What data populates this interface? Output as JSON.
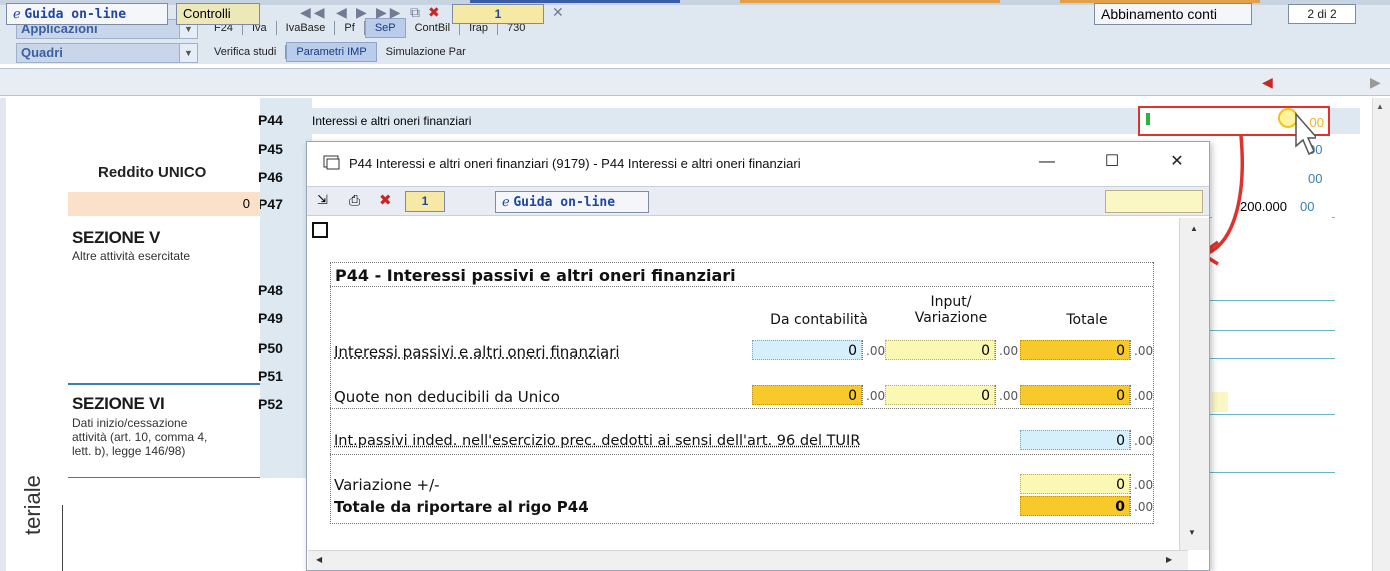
{
  "nav": {
    "combo1": "Applicazioni",
    "combo2": "Quadri",
    "tabs_row1": [
      "F24",
      "Iva",
      "IvaBase",
      "Pf",
      "SeP",
      "ContBil",
      "Irap",
      "730"
    ],
    "tabs_row2": [
      "Verifica studi",
      "Parametri IMP",
      "Simulazione Par"
    ]
  },
  "toolbar": {
    "guida": "Guida on-line",
    "controlli": "Controlli",
    "page": "1",
    "abbinamento": "Abbinamento conti",
    "page_of": "2 di 2"
  },
  "form": {
    "reddito_label": "Reddito UNICO",
    "reddito_value": "0",
    "rows": [
      "P44",
      "P45",
      "P46",
      "P47",
      "P48",
      "P49",
      "P50",
      "P51",
      "P52"
    ],
    "p44_label": "Interessi e altri oneri finanziari",
    "p45_cents": "00",
    "p46_cents": "00",
    "p47_value": "200.000",
    "p47_cents": "00",
    "sez5_title": "SEZIONE V",
    "sez5_sub": "Altre attività esercitate",
    "sez6_title": "SEZIONE VI",
    "sez6_sub": [
      "Dati inizio/cessazione",
      "attività (art. 10, comma 4,",
      "lett. b), legge 146/98)"
    ],
    "vertical_text": "teriale"
  },
  "popup": {
    "title": "P44 Interessi e altri oneri finanziari (9179) - P44 Interessi e altri oneri finanziari",
    "page": "1",
    "guida": "Guida on-line",
    "heading": "P44 - Interessi passivi e altri oneri finanziari",
    "col_contabilita": "Da contabilità",
    "col_input": [
      "Input/",
      "Variazione"
    ],
    "col_totale": "Totale",
    "row1_label": "Interessi passivi e altri oneri finanziari",
    "row1_values": [
      "0",
      "0",
      "0"
    ],
    "row2_label": "Quote non deducibili da Unico",
    "row2_values": [
      "0",
      "0",
      "0"
    ],
    "row3_label": "Int.passivi inded. nell'esercizio prec. dedotti ai sensi dell'art. 96 del TUIR",
    "row3_value": "0",
    "row4_label": "Variazione +/-",
    "row4_value": "0",
    "row5_label": "Totale da riportare al rigo P44",
    "row5_value": "0",
    "cents": ".00"
  },
  "colors": {
    "accent_red": "#e0312d",
    "blue_field": "#d6f0fb",
    "yellow_field": "#fbf8b4",
    "orange_field": "#f7c92a"
  }
}
